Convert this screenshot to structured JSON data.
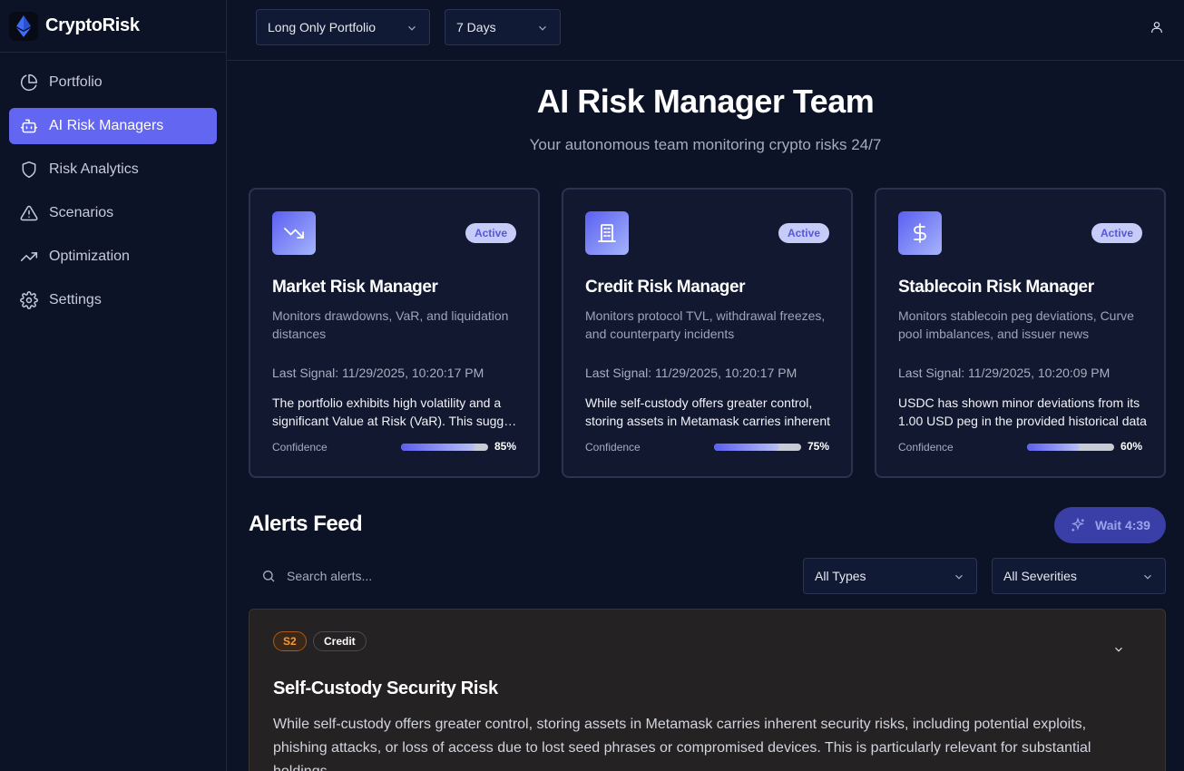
{
  "app": {
    "name": "CryptoRisk"
  },
  "sidebar": {
    "items": [
      {
        "label": "Portfolio",
        "icon": "pie-chart-icon"
      },
      {
        "label": "AI Risk Managers",
        "icon": "bot-icon",
        "active": true
      },
      {
        "label": "Risk Analytics",
        "icon": "shield-icon"
      },
      {
        "label": "Scenarios",
        "icon": "alert-triangle-icon"
      },
      {
        "label": "Optimization",
        "icon": "trending-up-icon"
      },
      {
        "label": "Settings",
        "icon": "gear-icon"
      }
    ]
  },
  "topbar": {
    "portfolio_select": "Long Only Portfolio",
    "period_select": "7 Days",
    "user_icon": "user-icon"
  },
  "page": {
    "title": "AI Risk Manager Team",
    "subtitle": "Your autonomous team monitoring crypto risks 24/7"
  },
  "managers": [
    {
      "icon": "trending-down-icon",
      "status": "Active",
      "title": "Market Risk Manager",
      "description": "Monitors drawdowns, VaR, and liquidation distances",
      "last_signal": "Last Signal: 11/29/2025, 10:20:17 PM",
      "summary_line1": "The portfolio exhibits high volatility and a",
      "summary_line2": "significant Value at Risk (VaR). This suggests",
      "confidence_label": "Confidence",
      "confidence": 85,
      "confidence_text": "85%"
    },
    {
      "icon": "building-icon",
      "status": "Active",
      "title": "Credit Risk Manager",
      "description": "Monitors protocol TVL, withdrawal freezes, and counterparty incidents",
      "last_signal": "Last Signal: 11/29/2025, 10:20:17 PM",
      "summary_line1": "While self-custody offers greater control,",
      "summary_line2": "storing assets in Metamask carries inherent",
      "confidence_label": "Confidence",
      "confidence": 75,
      "confidence_text": "75%"
    },
    {
      "icon": "dollar-icon",
      "status": "Active",
      "title": "Stablecoin Risk Manager",
      "description": "Monitors stablecoin peg deviations, Curve pool imbalances, and issuer news",
      "last_signal": "Last Signal: 11/29/2025, 10:20:09 PM",
      "summary_line1": "USDC has shown minor deviations from its",
      "summary_line2": "1.00 USD peg in the provided historical data",
      "confidence_label": "Confidence",
      "confidence": 60,
      "confidence_text": "60%"
    }
  ],
  "alerts": {
    "title": "Alerts Feed",
    "wait_button": "Wait 4:39",
    "search_placeholder": "Search alerts...",
    "type_filter": "All Types",
    "severity_filter": "All Severities",
    "items": [
      {
        "severity": "S2",
        "type": "Credit",
        "title": "Self-Custody Security Risk",
        "body": "While self-custody offers greater control, storing assets in Metamask carries inherent security risks, including potential exploits, phishing attacks, or loss of access due to lost seed phrases or compromised devices. This is particularly relevant for substantial holdings."
      }
    ]
  },
  "colors": {
    "background": "#0d1326",
    "accent": "#6366f1",
    "severity_s2": "#f59a3a"
  }
}
